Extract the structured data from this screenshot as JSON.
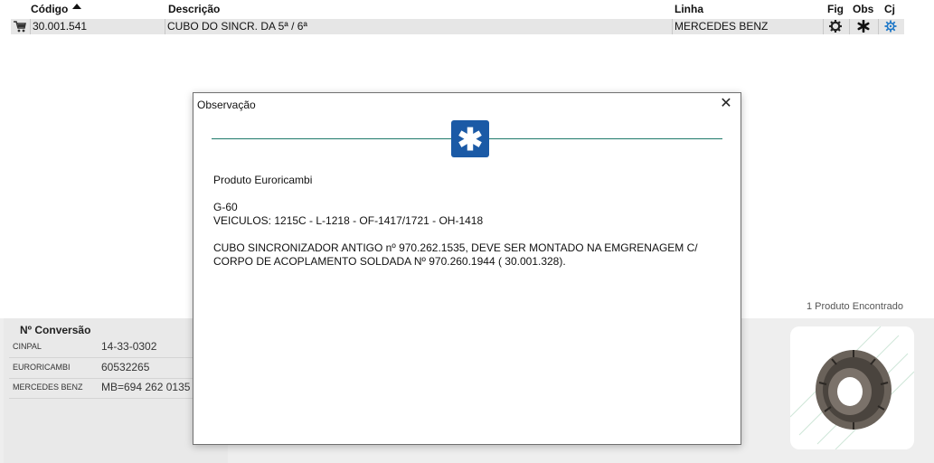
{
  "table": {
    "headers": {
      "codigo": "Código",
      "descricao": "Descrição",
      "linha": "Linha",
      "fig": "Fig",
      "obs": "Obs",
      "cj": "Cj"
    },
    "rows": [
      {
        "codigo": "30.001.541",
        "descricao": "CUBO DO SINCR. DA 5ª / 6ª",
        "linha": "MERCEDES BENZ"
      }
    ]
  },
  "results": {
    "found_text": "1 Produto Encontrado"
  },
  "conversion": {
    "title": "Nº Conversão",
    "rows": [
      {
        "brand": "CINPAL",
        "code": "14-33-0302"
      },
      {
        "brand": "EURORICAMBI",
        "code": "60532265"
      },
      {
        "brand": "MERCEDES BENZ",
        "code": "MB=694 262 0135"
      }
    ]
  },
  "modal": {
    "title": "Observação",
    "close_symbol": "✕",
    "badge_symbol": "✱",
    "lines": [
      "Produto Euroricambi",
      "G-60",
      "VEICULOS: 1215C - L-1218 - OF-1417/1721 - OH-1418",
      "CUBO SINCRONIZADOR ANTIGO nº 970.262.1535, DEVE SER MONTADO NA EMGRENAGEM C/",
      "CORPO DE ACOPLAMENTO SOLDADA Nº 970.260.1944 ( 30.001.328)."
    ]
  },
  "icons": {
    "cart": "cart-icon",
    "fig": "gear-icon",
    "obs": "asterisk-icon",
    "cj": "blue-gear-icon"
  },
  "colors": {
    "badge": "#1b5aa6",
    "divider": "#1f7a6b",
    "cj_icon": "#1e78c8"
  }
}
